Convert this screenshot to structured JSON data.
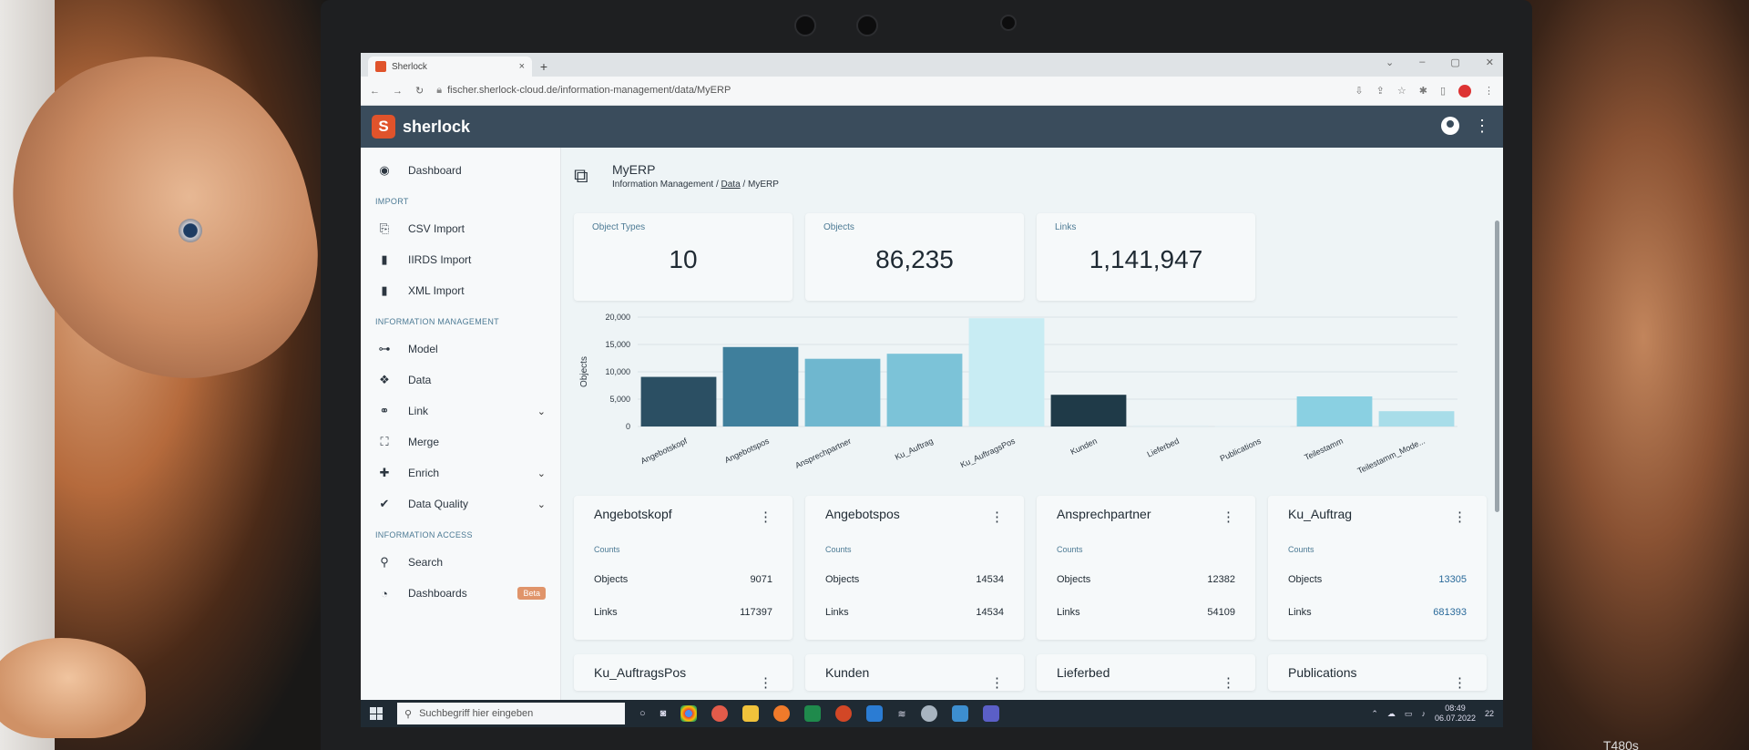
{
  "browser": {
    "tab_title": "Sherlock",
    "tab_close": "×",
    "new_tab": "+",
    "url": "fischer.sherlock-cloud.de/information-management/data/MyERP"
  },
  "app": {
    "logo_letter": "S",
    "name": "sherlock"
  },
  "sidebar": {
    "dashboard": "Dashboard",
    "import_label": "IMPORT",
    "import_items": [
      "CSV Import",
      "IIRDS Import",
      "XML Import"
    ],
    "im_label": "INFORMATION MANAGEMENT",
    "im_items": [
      "Model",
      "Data",
      "Link",
      "Merge",
      "Enrich",
      "Data Quality"
    ],
    "ia_label": "INFORMATION ACCESS",
    "ia_items": [
      "Search",
      "Dashboards"
    ],
    "beta": "Beta"
  },
  "page": {
    "title": "MyERP",
    "crumb_1": "Information Management",
    "crumb_sep": "/",
    "crumb_2": "Data",
    "crumb_3": "MyERP"
  },
  "stats": [
    {
      "label": "Object Types",
      "value": "10"
    },
    {
      "label": "Objects",
      "value": "86,235"
    },
    {
      "label": "Links",
      "value": "1,141,947"
    }
  ],
  "chart_data": {
    "type": "bar",
    "ylabel": "Objects",
    "ylim": [
      0,
      20000
    ],
    "yticks": [
      "20,000",
      "15,000",
      "10,000",
      "5,000",
      "0"
    ],
    "categories": [
      "Angebotskopf",
      "Angebotspos",
      "Ansprechpartner",
      "Ku_Auftrag",
      "Ku_AuftragsPos",
      "Kunden",
      "Lieferbed",
      "Publications",
      "Teilestamm",
      "Teilestamm_Mode..."
    ],
    "values": [
      9071,
      14534,
      12382,
      13305,
      19800,
      5800,
      200,
      100,
      5500,
      2800
    ],
    "colors": [
      "#2b4f63",
      "#3f7f9c",
      "#6fb7cf",
      "#7cc3d8",
      "#c8ecf3",
      "#1f3a48",
      "#e0eef2",
      "#e0eef2",
      "#8ad0e2",
      "#a8dde9"
    ]
  },
  "cards_label_counts": "Counts",
  "cards_label_objects": "Objects",
  "cards_label_links": "Links",
  "cards": [
    {
      "title": "Angebotskopf",
      "objects": "9071",
      "links": "117397"
    },
    {
      "title": "Angebotspos",
      "objects": "14534",
      "links": "14534"
    },
    {
      "title": "Ansprechpartner",
      "objects": "12382",
      "links": "54109"
    },
    {
      "title": "Ku_Auftrag",
      "objects": "13305",
      "links": "681393"
    }
  ],
  "cards_row2": [
    "Ku_AuftragsPos",
    "Kunden",
    "Lieferbed",
    "Publications"
  ],
  "taskbar": {
    "search_placeholder": "Suchbegriff hier eingeben",
    "time": "08:49",
    "date": "06.07.2022",
    "notifications": "22"
  },
  "model_label": "T480s"
}
